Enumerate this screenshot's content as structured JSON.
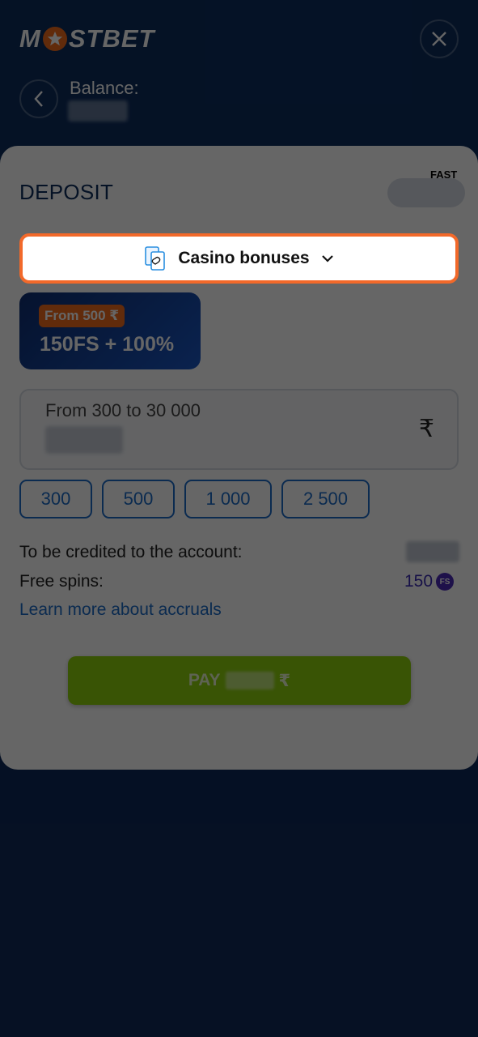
{
  "header": {
    "logo_text_left": "M",
    "logo_text_right": "STBET",
    "balance_label": "Balance:",
    "close_icon": "close-icon",
    "back_icon": "chevron-left-icon"
  },
  "deposit": {
    "title": "DEPOSIT",
    "fast_label": "FAST",
    "bonus_selector": {
      "label": "Casino bonuses",
      "icon": "cards-icon",
      "chevron": "chevron-down-icon"
    },
    "offer": {
      "badge": "From 500 ₹",
      "text": "150FS + 100%"
    },
    "amount_field": {
      "placeholder": "From 300 to 30 000",
      "currency_symbol": "₹"
    },
    "presets": [
      "300",
      "500",
      "1 000",
      "2 500"
    ],
    "credited_label": "To be credited to the account:",
    "free_spins_label": "Free spins:",
    "free_spins_value": "150",
    "free_spins_badge": "FS",
    "learn_more": "Learn more about accruals",
    "pay_label": "PAY",
    "pay_currency": "₹"
  },
  "colors": {
    "header_bg": "#0d2d5e",
    "accent_orange": "#f2692a",
    "link_blue": "#1c6bc8",
    "pay_green": "#8fd20e",
    "fs_purple": "#4d2bb8"
  }
}
